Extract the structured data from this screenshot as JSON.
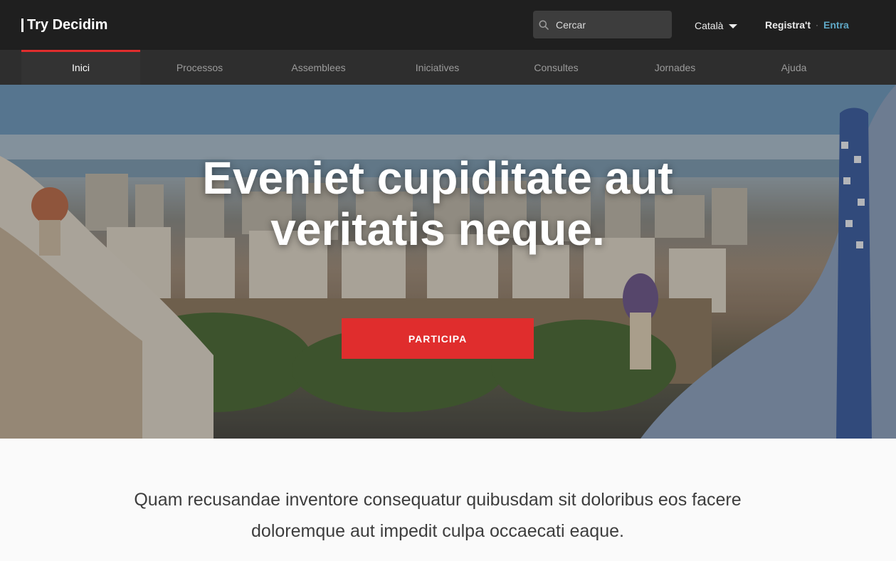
{
  "header": {
    "logo_text": "Try Decidim",
    "search_placeholder": "Cercar",
    "language": "Català",
    "register_label": "Registra't",
    "login_label": "Entra",
    "separator": "·"
  },
  "nav": {
    "items": [
      {
        "label": "Inici",
        "active": true
      },
      {
        "label": "Processos",
        "active": false
      },
      {
        "label": "Assemblees",
        "active": false
      },
      {
        "label": "Iniciatives",
        "active": false
      },
      {
        "label": "Consultes",
        "active": false
      },
      {
        "label": "Jornades",
        "active": false
      },
      {
        "label": "Ajuda",
        "active": false
      }
    ]
  },
  "hero": {
    "title": "Eveniet cupiditate aut veritatis neque.",
    "cta_label": "PARTICIPA"
  },
  "intro": {
    "text": "Quam recusandae inventore consequatur quibusdam sit doloribus eos facere doloremque aut impedit culpa occaecati eaque."
  },
  "colors": {
    "topbar": "#1f1f1f",
    "nav": "#2e2e2e",
    "accent": "#e02d2d",
    "link": "#5fa8c6"
  },
  "icons": {
    "search": "search-icon",
    "language_caret": "caret-down-icon"
  }
}
